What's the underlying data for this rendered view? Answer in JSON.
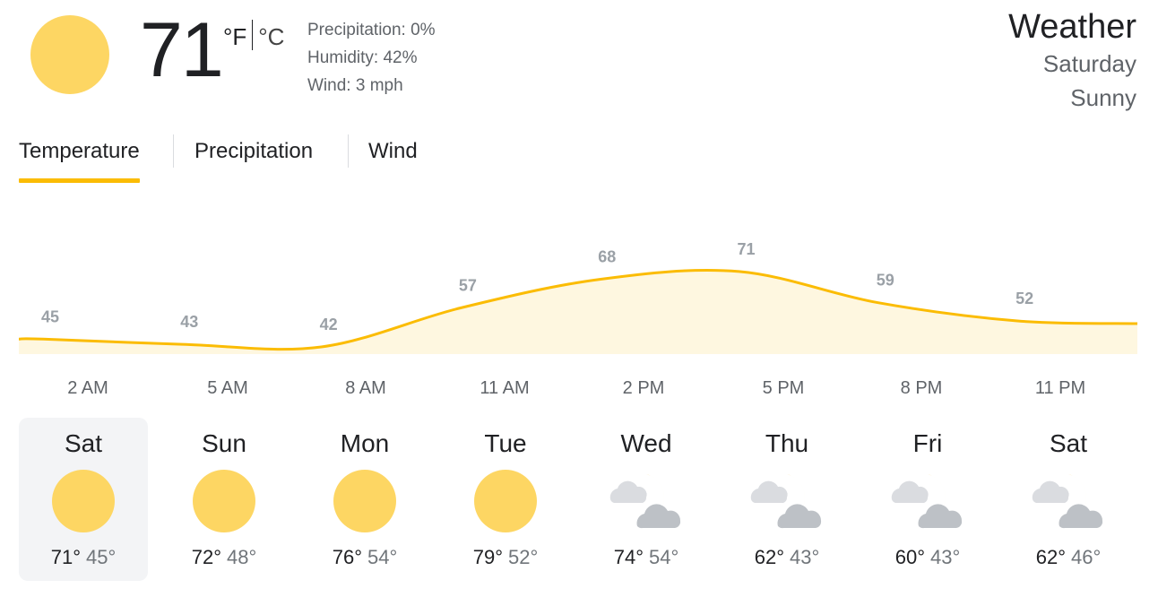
{
  "current": {
    "temperature": "71",
    "unit_f": "°F",
    "unit_c": "°C",
    "icon": "sun-icon",
    "precipitation": "Precipitation: 0%",
    "humidity": "Humidity: 42%",
    "wind": "Wind: 3 mph"
  },
  "header": {
    "title": "Weather",
    "day": "Saturday",
    "condition": "Sunny"
  },
  "tabs": [
    {
      "label": "Temperature",
      "active": true
    },
    {
      "label": "Precipitation",
      "active": false
    },
    {
      "label": "Wind",
      "active": false
    }
  ],
  "chart_data": {
    "type": "area",
    "xlabel": "",
    "ylabel": "",
    "x": [
      "2 AM",
      "5 AM",
      "8 AM",
      "11 AM",
      "2 PM",
      "5 PM",
      "8 PM",
      "11 PM"
    ],
    "series": [
      {
        "values": [
          45,
          43,
          42,
          57,
          68,
          71,
          59,
          52
        ]
      }
    ],
    "line_color": "#fbbc04",
    "fill_color": "#fef7e0",
    "label_color": "#9aa0a6"
  },
  "hours": [
    "2 AM",
    "5 AM",
    "8 AM",
    "11 AM",
    "2 PM",
    "5 PM",
    "8 PM",
    "11 PM"
  ],
  "days": [
    {
      "name": "Sat",
      "hi": "71°",
      "lo": "45°",
      "icon": "sun-icon",
      "selected": true
    },
    {
      "name": "Sun",
      "hi": "72°",
      "lo": "48°",
      "icon": "sun-icon",
      "selected": false
    },
    {
      "name": "Mon",
      "hi": "76°",
      "lo": "54°",
      "icon": "sun-icon",
      "selected": false
    },
    {
      "name": "Tue",
      "hi": "79°",
      "lo": "52°",
      "icon": "sun-icon",
      "selected": false
    },
    {
      "name": "Wed",
      "hi": "74°",
      "lo": "54°",
      "icon": "partly-cloudy-night-icon",
      "selected": false
    },
    {
      "name": "Thu",
      "hi": "62°",
      "lo": "43°",
      "icon": "partly-cloudy-night-icon",
      "selected": false
    },
    {
      "name": "Fri",
      "hi": "60°",
      "lo": "43°",
      "icon": "partly-cloudy-night-icon",
      "selected": false
    },
    {
      "name": "Sat",
      "hi": "62°",
      "lo": "46°",
      "icon": "partly-cloudy-night-icon",
      "selected": false
    }
  ],
  "colors": {
    "sun": "#fdd663",
    "accent": "#fbbc04",
    "selected_bg": "#f3f4f6",
    "cloud_dark": "#bdc1c6",
    "cloud_light": "#dadce0"
  }
}
